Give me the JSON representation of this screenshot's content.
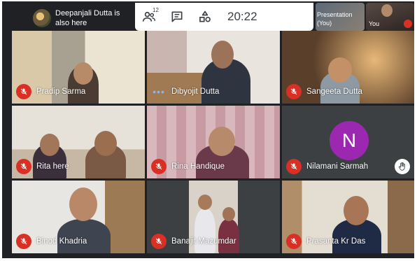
{
  "notification": {
    "text": "Deepanjali Dutta is also here"
  },
  "controls": {
    "participant_count": "12",
    "time": "20:22"
  },
  "presentation": {
    "label": "Presentation (You)"
  },
  "self_view": {
    "label": "You"
  },
  "participants": [
    {
      "name": "Pradip Sarma",
      "muted": true
    },
    {
      "name": "Dibyojit Dutta",
      "muted": false
    },
    {
      "name": "Sangeeta Dutta",
      "muted": true
    },
    {
      "name": "Rita here",
      "muted": true
    },
    {
      "name": "Rina Handique",
      "muted": true
    },
    {
      "name": "Nilamani Sarmah",
      "muted": true,
      "avatar_letter": "N",
      "avatar_color": "#9c27b0",
      "hand_raised": true
    },
    {
      "name": "Binod Khadria",
      "muted": true
    },
    {
      "name": "Banajit Mazumdar",
      "muted": true
    },
    {
      "name": "Prasanta Kr Das",
      "muted": true
    }
  ],
  "colors": {
    "muted_red": "#d93025",
    "speaking_blue": "#8ab4f8",
    "background": "#202124"
  }
}
